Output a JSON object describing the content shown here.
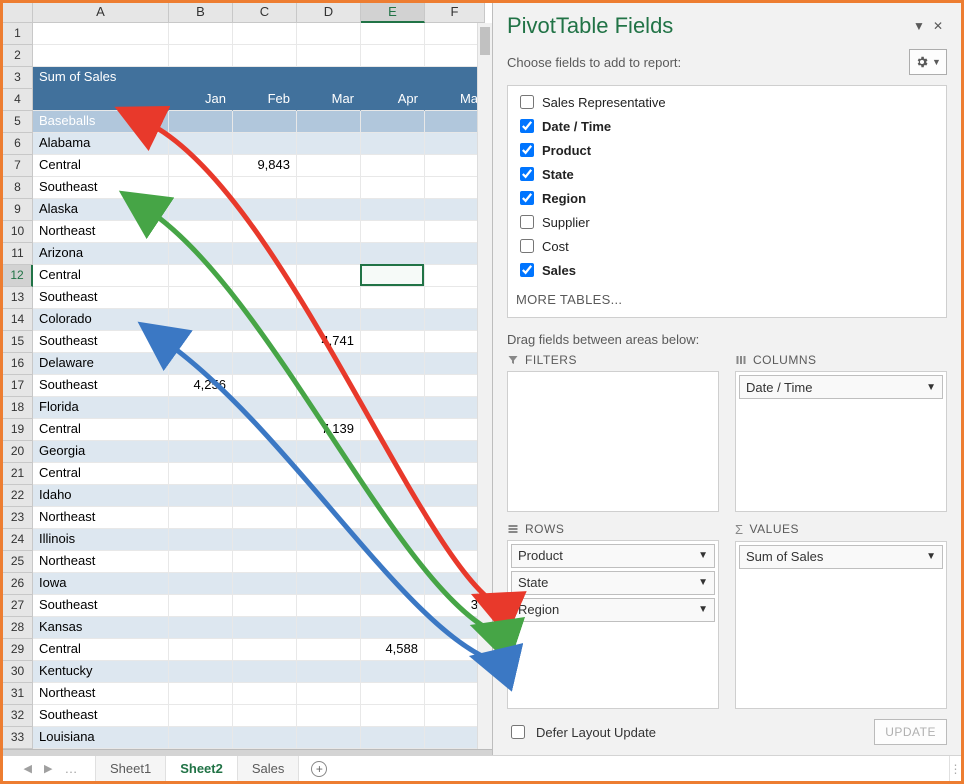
{
  "sheet": {
    "cols": [
      "A",
      "B",
      "C",
      "D",
      "E",
      "F"
    ],
    "selected_cell": {
      "row": 12,
      "col": "E"
    },
    "rows": [
      {
        "n": 1,
        "type": "blank"
      },
      {
        "n": 2,
        "type": "blank"
      },
      {
        "n": 3,
        "type": "hdr",
        "A": "Sum of Sales"
      },
      {
        "n": 4,
        "type": "hdr-months",
        "B": "Jan",
        "C": "Feb",
        "D": "Mar",
        "E": "Apr",
        "F": "Ma"
      },
      {
        "n": 5,
        "type": "lvl0",
        "A": "Baseballs"
      },
      {
        "n": 6,
        "type": "lvl1",
        "A": "Alabama"
      },
      {
        "n": 7,
        "type": "lvl2",
        "A": "Central",
        "C": "9,843"
      },
      {
        "n": 8,
        "type": "lvl2",
        "A": "Southeast"
      },
      {
        "n": 9,
        "type": "lvl1",
        "A": "Alaska"
      },
      {
        "n": 10,
        "type": "lvl2",
        "A": "Northeast"
      },
      {
        "n": 11,
        "type": "lvl1",
        "A": "Arizona"
      },
      {
        "n": 12,
        "type": "lvl2",
        "A": "Central"
      },
      {
        "n": 13,
        "type": "lvl2",
        "A": "Southeast"
      },
      {
        "n": 14,
        "type": "lvl1",
        "A": "Colorado"
      },
      {
        "n": 15,
        "type": "lvl2",
        "A": "Southeast",
        "D": "4,741"
      },
      {
        "n": 16,
        "type": "lvl1",
        "A": "Delaware"
      },
      {
        "n": 17,
        "type": "lvl2",
        "A": "Southeast",
        "B": "4,256"
      },
      {
        "n": 18,
        "type": "lvl1",
        "A": "Florida"
      },
      {
        "n": 19,
        "type": "lvl2",
        "A": "Central",
        "D": "7,139"
      },
      {
        "n": 20,
        "type": "lvl1",
        "A": "Georgia"
      },
      {
        "n": 21,
        "type": "lvl2",
        "A": "Central"
      },
      {
        "n": 22,
        "type": "lvl1",
        "A": "Idaho"
      },
      {
        "n": 23,
        "type": "lvl2",
        "A": "Northeast"
      },
      {
        "n": 24,
        "type": "lvl1",
        "A": "Illinois"
      },
      {
        "n": 25,
        "type": "lvl2",
        "A": "Northeast"
      },
      {
        "n": 26,
        "type": "lvl1",
        "A": "Iowa"
      },
      {
        "n": 27,
        "type": "lvl2",
        "A": "Southeast",
        "F": "3"
      },
      {
        "n": 28,
        "type": "lvl1",
        "A": "Kansas"
      },
      {
        "n": 29,
        "type": "lvl2",
        "A": "Central",
        "E": "4,588"
      },
      {
        "n": 30,
        "type": "lvl1",
        "A": "Kentucky"
      },
      {
        "n": 31,
        "type": "lvl2",
        "A": "Northeast"
      },
      {
        "n": 32,
        "type": "lvl2",
        "A": "Southeast"
      },
      {
        "n": 33,
        "type": "lvl1",
        "A": "Louisiana"
      }
    ]
  },
  "pane": {
    "title": "PivotTable Fields",
    "choose": "Choose fields to add to report:",
    "drag": "Drag fields between areas below:",
    "more": "MORE TABLES...",
    "defer": "Defer Layout Update",
    "update": "UPDATE",
    "areas": {
      "filters": "FILTERS",
      "columns": "COLUMNS",
      "rows": "ROWS",
      "values": "VALUES"
    },
    "fields": [
      {
        "label": "Sales Representative",
        "checked": false
      },
      {
        "label": "Date / Time",
        "checked": true
      },
      {
        "label": "Product",
        "checked": true
      },
      {
        "label": "State",
        "checked": true
      },
      {
        "label": "Region",
        "checked": true
      },
      {
        "label": "Supplier",
        "checked": false
      },
      {
        "label": "Cost",
        "checked": false
      },
      {
        "label": "Sales",
        "checked": true
      }
    ],
    "zone_filters": [],
    "zone_columns": [
      "Date / Time"
    ],
    "zone_rows": [
      "Product",
      "State",
      "Region"
    ],
    "zone_values": [
      "Sum of Sales"
    ]
  },
  "tabs": [
    "Sheet1",
    "Sheet2",
    "Sales"
  ],
  "colors": {
    "accent": "#217346",
    "header_bg": "#41719C",
    "band1": "#DDE7F0",
    "lvl0": "#B1C7DC",
    "arrow_red": "#E8392B",
    "arrow_green": "#46A546",
    "arrow_blue": "#3B78C4"
  }
}
